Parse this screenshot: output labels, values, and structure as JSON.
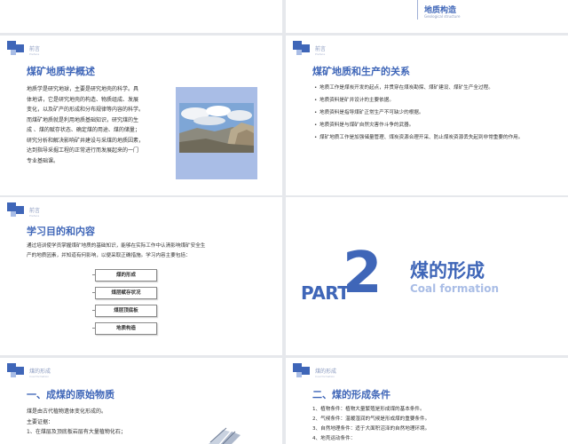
{
  "slide_top_left": {},
  "slide_top_right": {
    "title": "地质构造",
    "subtitle": "Geological structure"
  },
  "slide_overview": {
    "section_label": "前言",
    "section_sub": "Preface",
    "heading": "煤矿地质学概述",
    "paragraph_lines": [
      "地质学是研究地球，主要是研究地壳的科学。具",
      "体地讲，它是研究地壳的构造、物质组成、发展",
      "变化，以及矿产的形成和分布规律等内容的科学。",
      "而煤矿地质就是利用地质基础知识，研究煤的生",
      "成 、煤的赋存状态、确定煤的用途、煤的储量；",
      "研究分析和解决影响矿井建设与采煤的地质因素，",
      "达到指导采掘工程的正常进行而发展起来的一门",
      "专业基础课。"
    ]
  },
  "slide_relation": {
    "section_label": "前言",
    "section_sub": "Preface",
    "heading": "煤矿地质和生产的关系",
    "bullets": [
      "地质工作是煤炭开发的起点，并贯穿在煤炭勘探、煤矿建设、煤矿生产全过程。",
      "地质资料是矿井设计的主要依据。",
      "地质资料是指导煤矿正常生产不可缺少的根据。",
      "地质资料是与煤矿自然灾害作斗争的武器。",
      "煤矿地质工作是加强储量管理、煤炭资源合理开采、防止煤炭资源丢失起到非常重要的作用。"
    ]
  },
  "slide_goals": {
    "section_label": "前言",
    "section_sub": "Preface",
    "heading": "学习目的和内容",
    "paragraph_lines": [
      "通过培训使学员掌握煤矿地质的基础知识，能够在实际工作中认清影响煤矿安全生",
      "产的地质因素，并知道有何影响，以便采取正确措施。学习内容主要包括："
    ],
    "items": [
      "煤的形成",
      "煤层赋存状况",
      "煤层顶底板",
      "地质构造"
    ]
  },
  "slide_part2": {
    "part_word": "PART",
    "part_number": "2",
    "title_cn": "煤的形成",
    "title_en": "Coal formation"
  },
  "slide_origin": {
    "section_label": "煤的形成",
    "section_sub": "Coal formation",
    "heading": "一、成煤的原始物质",
    "lines": [
      "煤是由古代植物遗体变化形成的。",
      "主要证据：",
      "1、在煤层及顶底板岩层有大量植物化石；"
    ]
  },
  "slide_conditions": {
    "section_label": "煤的形成",
    "section_sub": "Coal formation",
    "heading": "二、煤的形成条件",
    "lines": [
      "1、植物条件：植物大量繁殖是形成煤的基本条件。",
      "2、气候条件：温暖湿润的气候是形成煤的重要条件。",
      "3、自然地理条件：适于大面积沼泽的自然地理环境。",
      "4、地壳运动条件："
    ]
  },
  "colors": {
    "accent": "#3f66b8",
    "accent_light": "#a9bde6",
    "background": "#e6e8ec"
  }
}
